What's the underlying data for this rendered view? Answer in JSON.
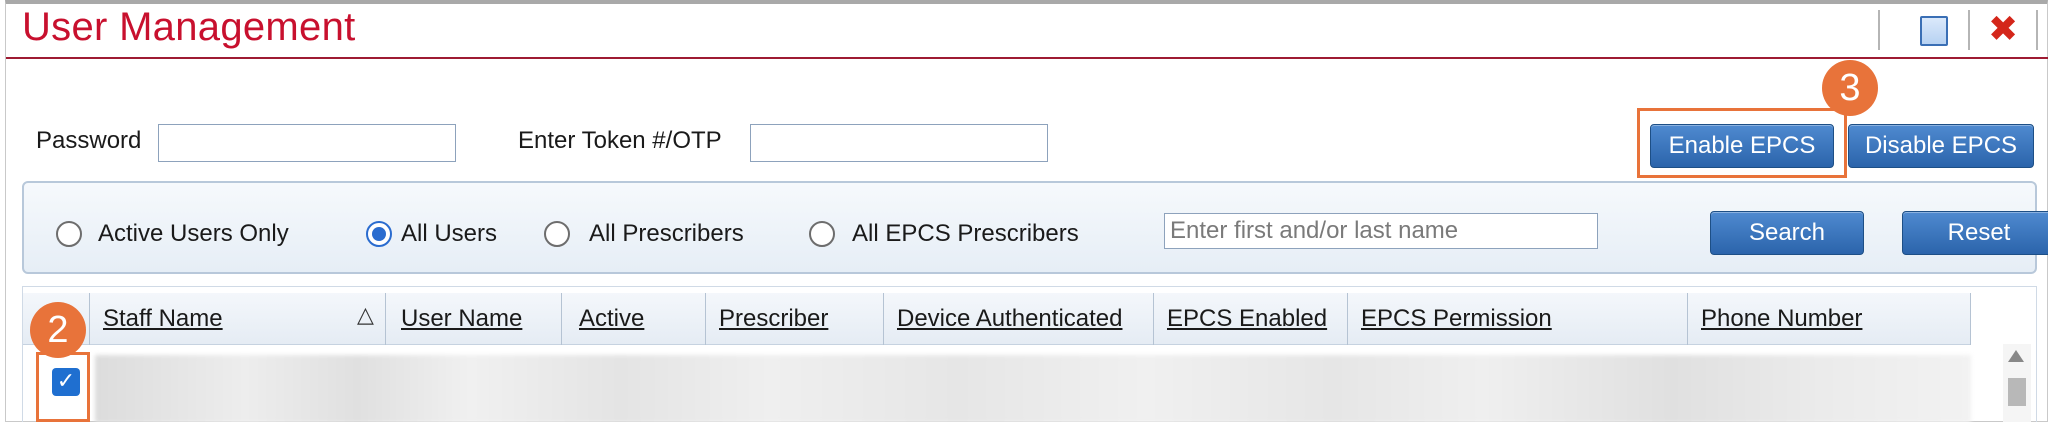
{
  "window": {
    "title": "User Management"
  },
  "toolbar": {
    "icons": [
      "document-icon",
      "close-icon"
    ],
    "close_glyph": "✖"
  },
  "credentials": {
    "password_label": "Password",
    "password_value": "",
    "token_label": "Enter Token #/OTP",
    "token_value": ""
  },
  "epcs": {
    "enable_label": "Enable EPCS",
    "disable_label": "Disable EPCS"
  },
  "filters": {
    "options": [
      {
        "label": "Active Users Only",
        "selected": false
      },
      {
        "label": "All Users",
        "selected": true
      },
      {
        "label": "All Prescribers",
        "selected": false
      },
      {
        "label": "All EPCS Prescribers",
        "selected": false
      }
    ],
    "name_placeholder": "Enter first and/or last name",
    "search_label": "Search",
    "reset_label": "Reset"
  },
  "table": {
    "columns": [
      "Staff Name",
      "User Name",
      "Active",
      "Prescriber",
      "Device Authenticated",
      "EPCS Enabled",
      "EPCS Permission",
      "Phone Number"
    ],
    "sort_glyph": "△",
    "row_checked": true,
    "check_glyph": "✓"
  },
  "callouts": {
    "step_2": "2",
    "step_3": "3"
  },
  "colors": {
    "title": "#c8102e",
    "button": "#2b64ab",
    "callout": "#e8733a",
    "radio_selected": "#2a6ccf"
  }
}
